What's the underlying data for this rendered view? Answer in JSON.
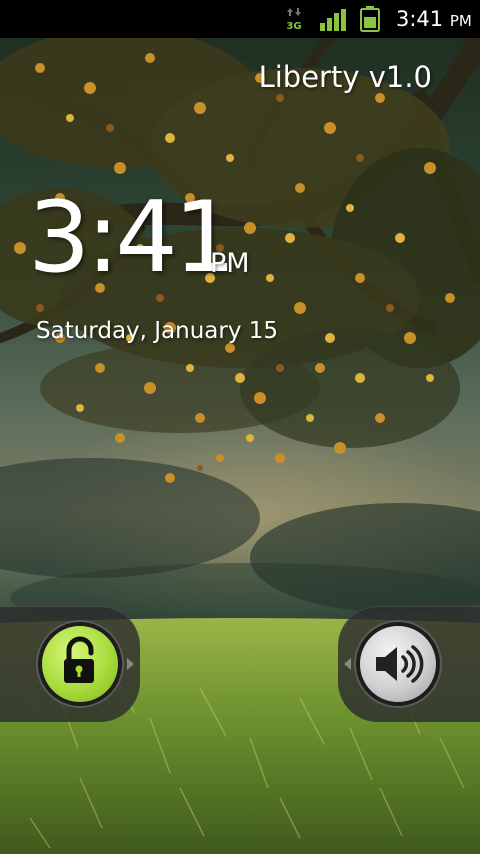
{
  "status_bar": {
    "network_type": "3G",
    "network_icon": "3g-data-icon",
    "signal_icon": "signal-strength-icon",
    "battery_icon": "battery-icon",
    "time": "3:41",
    "ampm": "PM"
  },
  "lockscreen": {
    "carrier_label": "Liberty v1.0",
    "time": "3:41",
    "ampm": "PM",
    "date": "Saturday, January 15",
    "unlock_icon": "unlock-padlock-icon",
    "sound_icon": "speaker-volume-icon"
  },
  "colors": {
    "status_bar_bg": "#000000",
    "status_icon_green": "#8bc540",
    "unlock_knob": "#a8dc3c",
    "sound_knob": "#cfcfcf",
    "tab_bg": "#2d2d2d"
  },
  "wallpaper": "autumn-tree-over-grass-field"
}
